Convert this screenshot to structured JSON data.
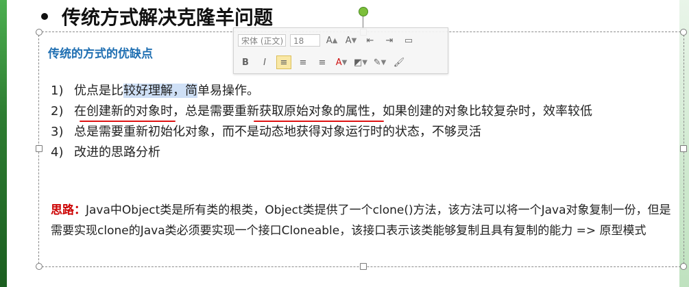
{
  "title": {
    "bullet": "●",
    "text": "传统方式解决克隆羊问题"
  },
  "section": {
    "title": "传统的方式的优缺点"
  },
  "toolbar": {
    "font_name": "宋体 (正文)",
    "font_size": "18",
    "grow_font": "A",
    "shrink_font": "A",
    "bold": "B",
    "italic": "I",
    "font_color": "A"
  },
  "list": [
    {
      "num": "1)",
      "pre": "优点是比",
      "highlight": "较好理解，简",
      "post": "单易操作。"
    },
    {
      "num": "2)",
      "text": "在创建新的对象时，总是需要重新获取原始对象的属性，如果创建的对象比较复杂时，效率较低"
    },
    {
      "num": "3)",
      "text": "总是需要重新初始化对象，而不是动态地获得对象运行时的状态，不够灵活"
    },
    {
      "num": "4)",
      "text": "改进的思路分析"
    }
  ],
  "thinking": {
    "label": "思路：",
    "text": "Java中Object类是所有类的根类，Object类提供了一个clone()方法，该方法可以将一个Java对象复制一份，但是需要实现clone的Java类必须要实现一个接口Cloneable，该接口表示该类能够复制且具有复制的能力 => 原型模式"
  }
}
